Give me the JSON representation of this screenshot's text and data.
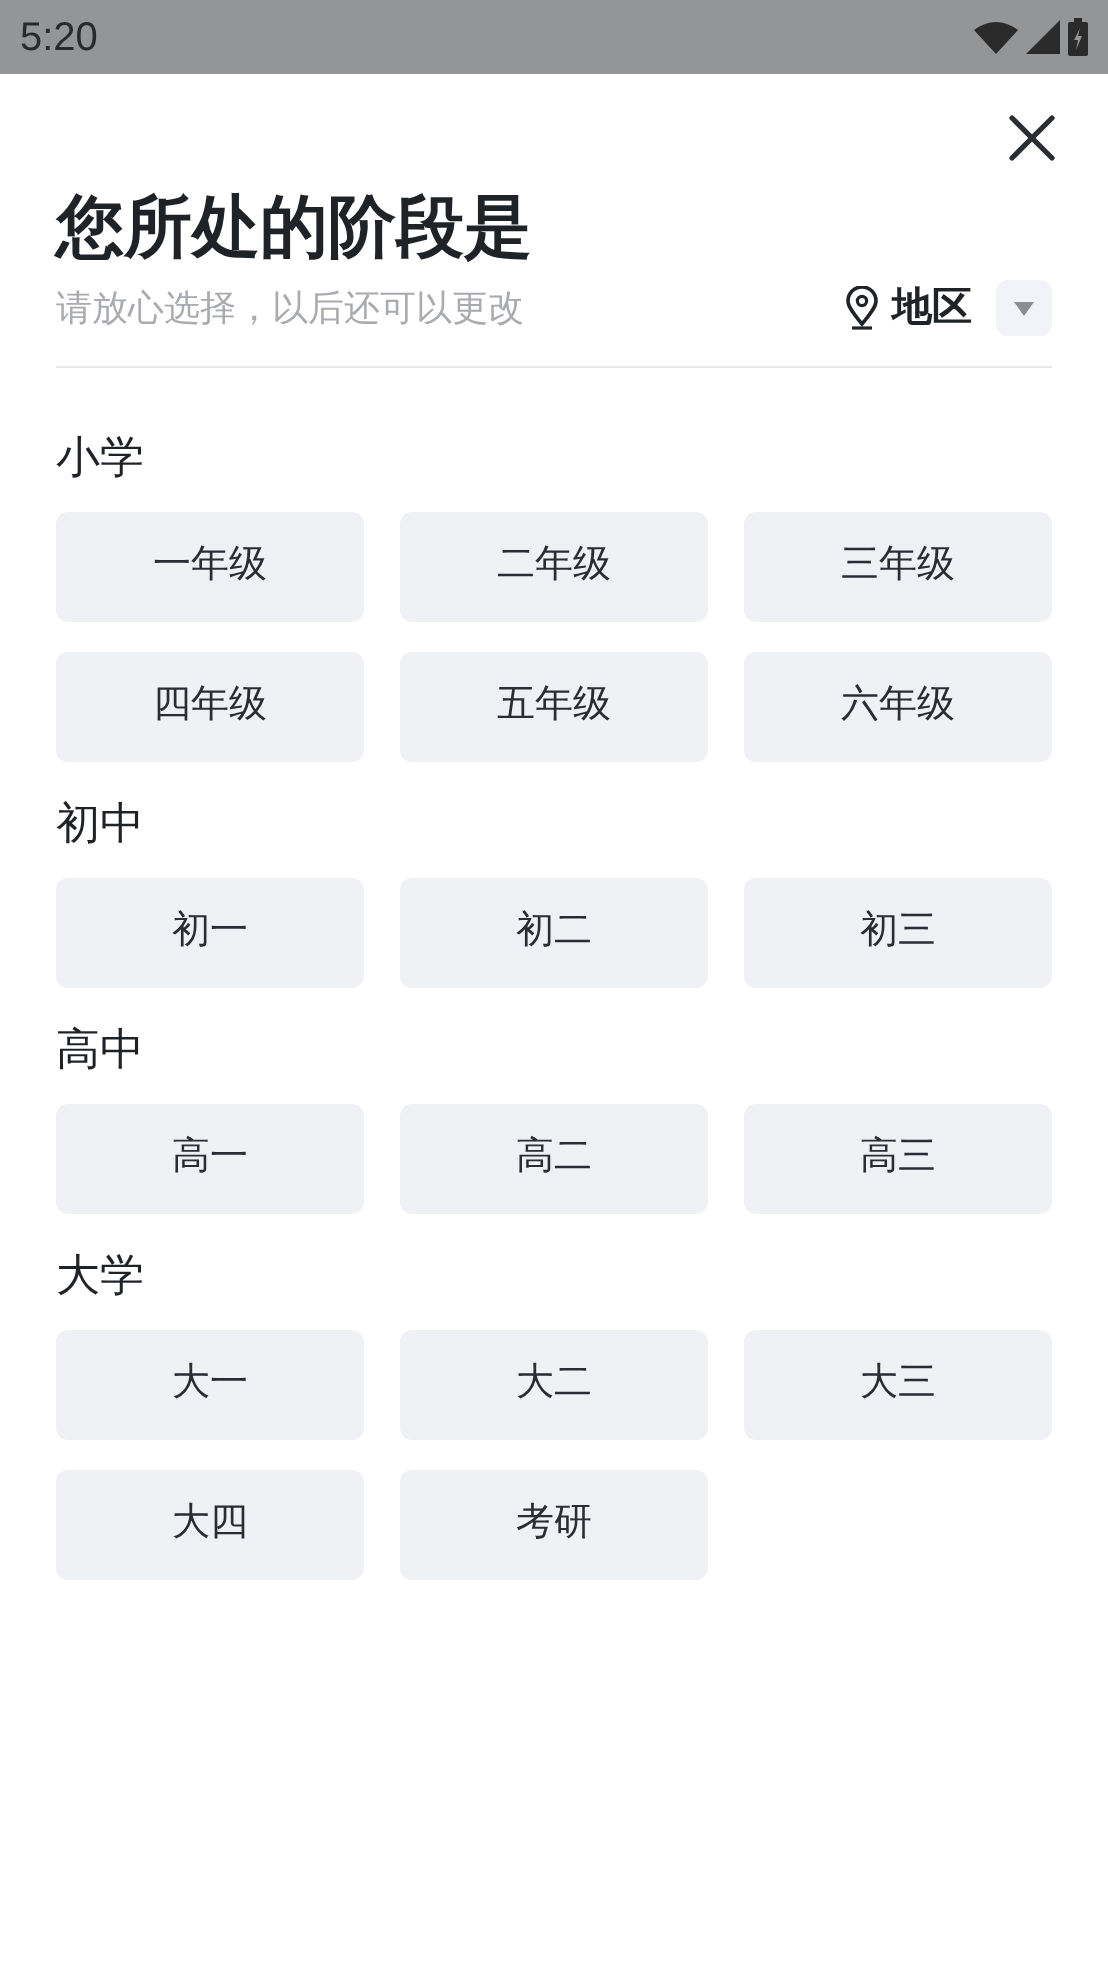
{
  "status_bar": {
    "time": "5:20"
  },
  "title": "您所处的阶段是",
  "subtitle": "请放心选择，以后还可以更改",
  "region": {
    "label": "地区"
  },
  "sections": [
    {
      "heading": "小学",
      "options": [
        "一年级",
        "二年级",
        "三年级",
        "四年级",
        "五年级",
        "六年级"
      ]
    },
    {
      "heading": "初中",
      "options": [
        "初一",
        "初二",
        "初三"
      ]
    },
    {
      "heading": "高中",
      "options": [
        "高一",
        "高二",
        "高三"
      ]
    },
    {
      "heading": "大学",
      "options": [
        "大一",
        "大二",
        "大三",
        "大四",
        "考研"
      ]
    }
  ]
}
